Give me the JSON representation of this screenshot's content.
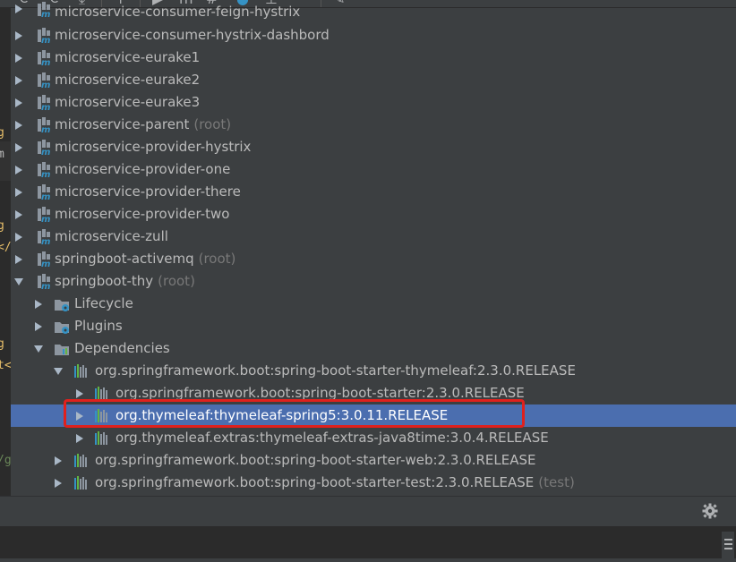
{
  "colors": {
    "background": "#3c3f41",
    "selection": "#4b6eaf",
    "highlight_box": "#e0201d",
    "muted_text": "#787878",
    "text": "#bbbbbb"
  },
  "toolbar": {
    "icons": [
      "refresh-icon",
      "generate-sources-icon",
      "download-icon",
      "add-icon",
      "run-icon",
      "maven-icon",
      "toggle-offline-icon",
      "help-icon",
      "show-dependencies-icon",
      "collapse-icon",
      "settings-wrench-icon"
    ]
  },
  "editor_fragment": {
    "lines": [
      "g",
      "m",
      "g",
      "</",
      "g",
      "t<",
      "/g"
    ]
  },
  "tree": {
    "rows": [
      {
        "label": "microservice-consumer-feign-hystrix",
        "suffix": ""
      },
      {
        "label": "microservice-consumer-hystrix-dashbord",
        "suffix": ""
      },
      {
        "label": "microservice-eurake1",
        "suffix": ""
      },
      {
        "label": "microservice-eurake2",
        "suffix": ""
      },
      {
        "label": "microservice-eurake3",
        "suffix": ""
      },
      {
        "label": "microservice-parent",
        "suffix": "(root)"
      },
      {
        "label": "microservice-provider-hystrix",
        "suffix": ""
      },
      {
        "label": "microservice-provider-one",
        "suffix": ""
      },
      {
        "label": "microservice-provider-there",
        "suffix": ""
      },
      {
        "label": "microservice-provider-two",
        "suffix": ""
      },
      {
        "label": "microservice-zull",
        "suffix": ""
      },
      {
        "label": "springboot-activemq",
        "suffix": "(root)"
      },
      {
        "label": "springboot-thy",
        "suffix": "(root)"
      },
      {
        "label": "Lifecycle",
        "suffix": ""
      },
      {
        "label": "Plugins",
        "suffix": ""
      },
      {
        "label": "Dependencies",
        "suffix": ""
      },
      {
        "label": "org.springframework.boot:spring-boot-starter-thymeleaf:2.3.0.RELEASE",
        "suffix": ""
      },
      {
        "label": "org.springframework.boot:spring-boot-starter:2.3.0.RELEASE",
        "suffix": ""
      },
      {
        "label": "org.thymeleaf:thymeleaf-spring5:3.0.11.RELEASE",
        "suffix": "",
        "selected": true
      },
      {
        "label": "org.thymeleaf.extras:thymeleaf-extras-java8time:3.0.4.RELEASE",
        "suffix": ""
      },
      {
        "label": "org.springframework.boot:spring-boot-starter-web:2.3.0.RELEASE",
        "suffix": ""
      },
      {
        "label": "org.springframework.boot:spring-boot-starter-test:2.3.0.RELEASE",
        "suffix": "(test)"
      }
    ]
  }
}
